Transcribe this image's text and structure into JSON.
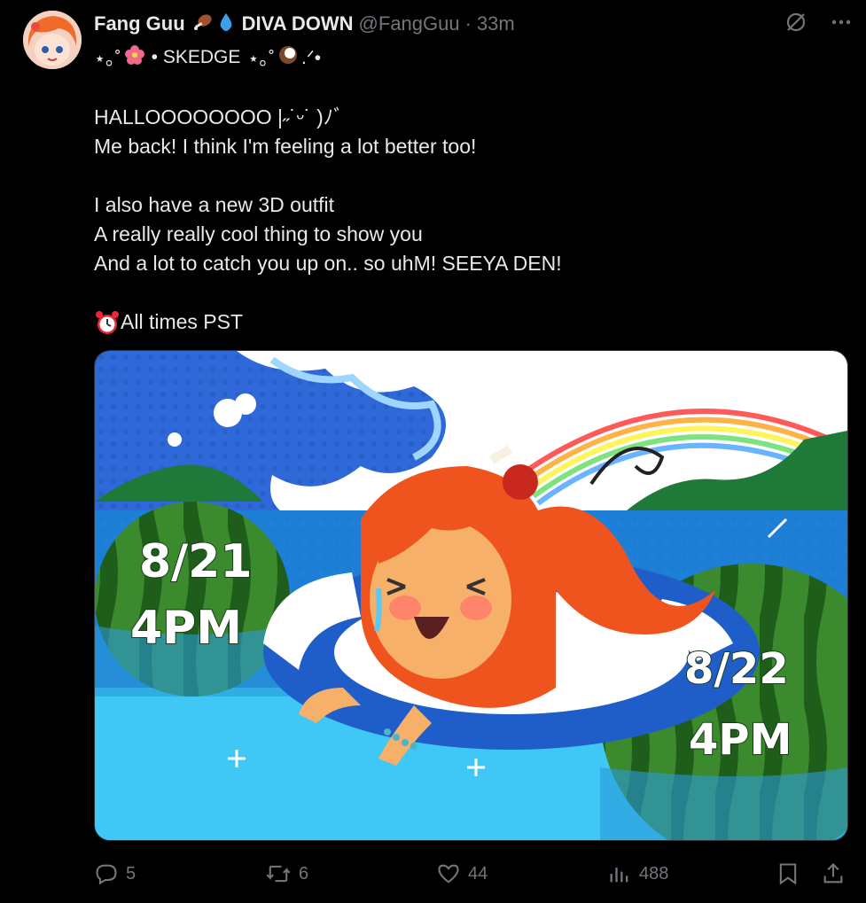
{
  "tweet": {
    "display_name": "Fang Guu",
    "display_name_suffix": "DIVA DOWN",
    "handle": "@FangGuu",
    "separator": "·",
    "time": "33m",
    "subline_text": "• SKEDGE",
    "subline_deco_left": "⋆｡˚",
    "subline_deco_mid": "⋆｡˚",
    "subline_deco_right": ".ᐟ•",
    "lines": [
      "HALLOOOOOOOO |˶˙ᵕ˙ )ﾉﾞ",
      "Me back! I think I'm feeling a lot better too!",
      "",
      "I also have a new 3D outfit",
      "A really really cool thing to show you",
      "And a lot to catch you up on.. so uhM! SEEYA DEN!",
      "",
      "All times PST"
    ],
    "alarm_emoji": "⏰"
  },
  "media": {
    "date1": "8/21",
    "time1": "4PM",
    "date2": "8/22",
    "time2": "4PM"
  },
  "actions": {
    "replies": "5",
    "reposts": "6",
    "likes": "44",
    "views": "488"
  },
  "colors": {
    "accent": "#1d9bf0",
    "muted": "#71767b",
    "text": "#e7e9ea",
    "background": "#000000"
  }
}
